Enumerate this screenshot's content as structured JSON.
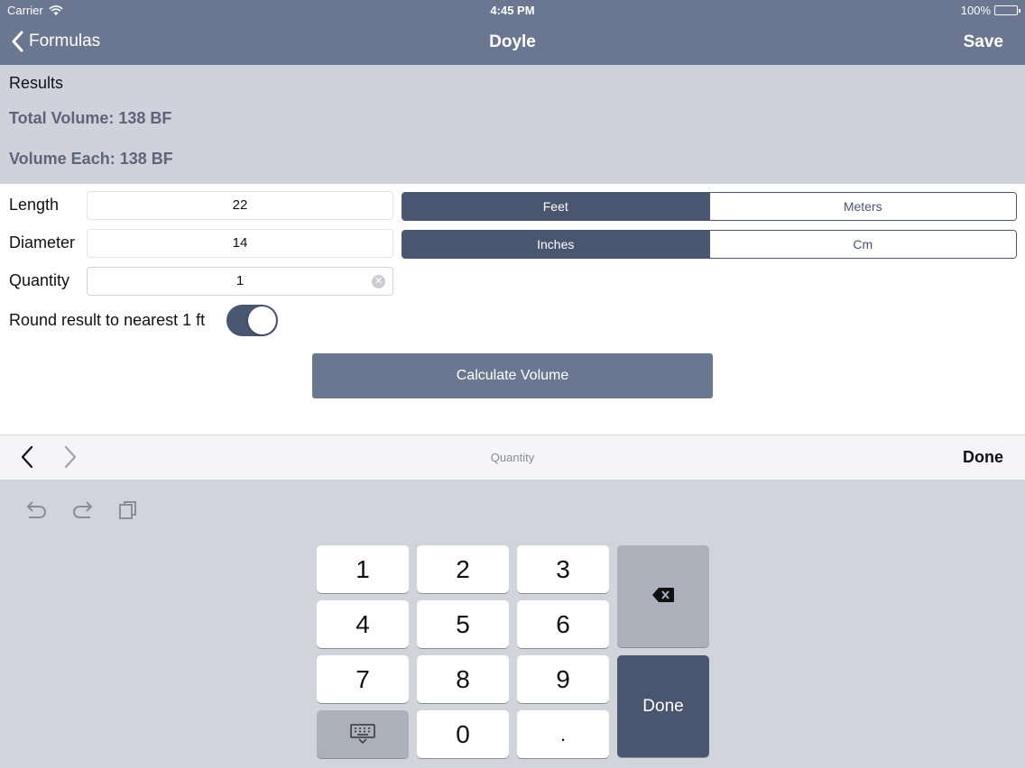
{
  "status_bar": {
    "carrier": "Carrier",
    "time": "4:45 PM",
    "battery": "100%"
  },
  "nav": {
    "back_label": "Formulas",
    "title": "Doyle",
    "save_label": "Save"
  },
  "results": {
    "title": "Results",
    "total_volume": "Total Volume: 138 BF",
    "volume_each": "Volume Each: 138 BF"
  },
  "form": {
    "length": {
      "label": "Length",
      "value": "22",
      "units": [
        "Feet",
        "Meters"
      ],
      "selected_unit": "Feet"
    },
    "diameter": {
      "label": "Diameter",
      "value": "14",
      "units": [
        "Inches",
        "Cm"
      ],
      "selected_unit": "Inches"
    },
    "quantity": {
      "label": "Quantity",
      "value": "1"
    },
    "round": {
      "label": "Round result to nearest 1 ft",
      "on": true
    },
    "calculate_label": "Calculate Volume"
  },
  "accessory": {
    "field_title": "Quantity",
    "done_label": "Done"
  },
  "keyboard": {
    "keys": [
      "1",
      "2",
      "3",
      "4",
      "5",
      "6",
      "7",
      "8",
      "9",
      "0",
      "."
    ],
    "done_label": "Done"
  },
  "colors": {
    "accent": "#4a5570",
    "nav": "#6b7790",
    "results_bg": "#cfd2da",
    "keyboard_bg": "#d1d4db"
  }
}
